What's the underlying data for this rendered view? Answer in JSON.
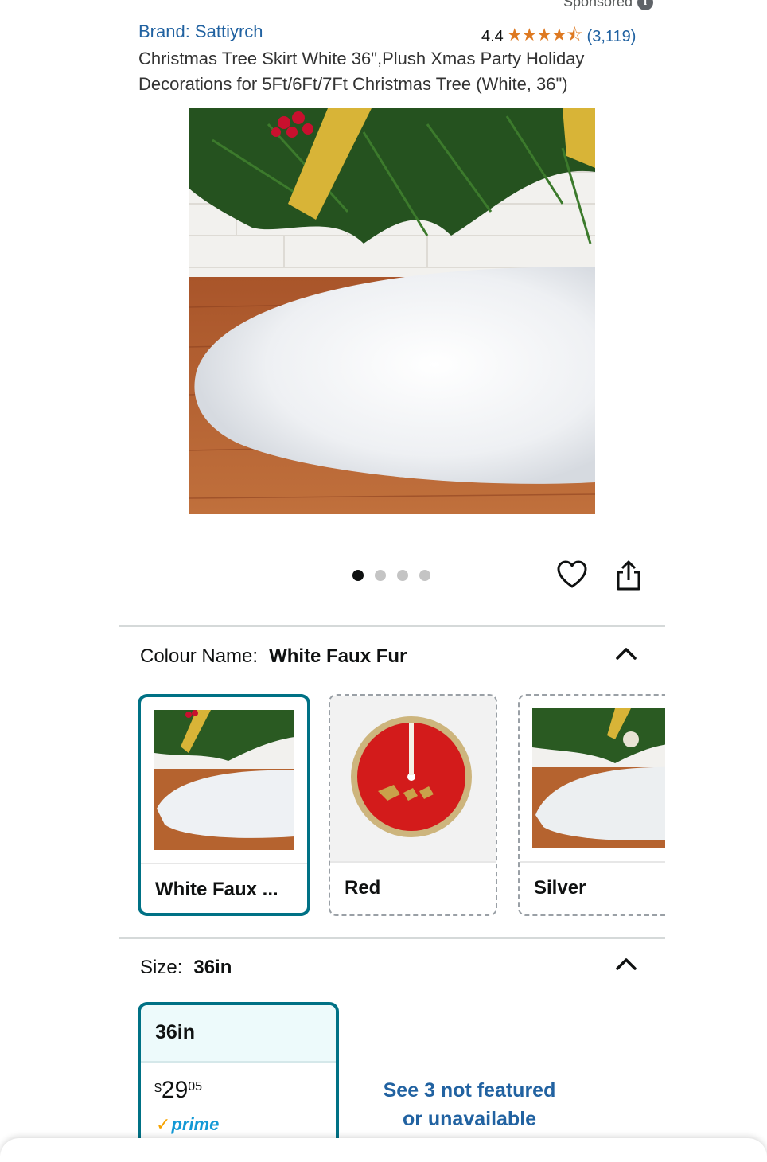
{
  "header": {
    "sponsored_label": "Sponsored",
    "info_icon": "i"
  },
  "product": {
    "brand": "Brand: Sattiyrch",
    "rating_value": "4.4",
    "rating_stars": 4.4,
    "rating_stars_text": "★★★★⯪",
    "rating_count": "(3,119)",
    "title": "Christmas Tree Skirt White 36\",Plush Xmas Party Holiday Decorations for 5Ft/6Ft/7Ft Christmas Tree (White, 36\")",
    "image_count": 4,
    "active_image_index": 0
  },
  "colour": {
    "label": "Colour Name:",
    "selected": "White Faux Fur",
    "options": [
      {
        "label": "White Faux ..."
      },
      {
        "label": "Red"
      },
      {
        "label": "Silver"
      }
    ]
  },
  "size": {
    "label": "Size:",
    "selected": "36in",
    "card_label": "36in",
    "price_currency": "$",
    "price_whole": "29",
    "price_fraction": "05",
    "prime_check": "✓",
    "prime_label": "prime",
    "see_more_line1": "See 3 not featured",
    "see_more_line2": "or unavailable"
  },
  "colors": {
    "link": "#2162a1",
    "accent": "#007185",
    "star": "#de7921",
    "prime": "#1399d6"
  }
}
